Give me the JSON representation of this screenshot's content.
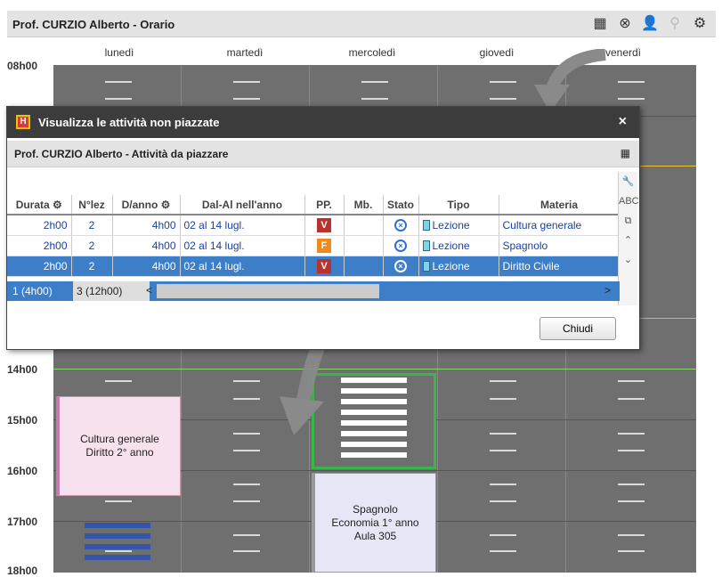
{
  "window": {
    "title": "Prof. CURZIO Alberto - Orario"
  },
  "toolbar_icons": [
    "timetable-icon",
    "cancel-icon",
    "person-icon",
    "search-icon",
    "gear-icon"
  ],
  "days": [
    "lunedì",
    "martedì",
    "mercoledì",
    "giovedì",
    "venerdì"
  ],
  "hours": [
    "08h00",
    "14h00",
    "15h00",
    "16h00",
    "17h00",
    "18h00"
  ],
  "schedule": {
    "card_monday": {
      "line1": "Cultura generale",
      "line2": "Diritto 2° anno"
    },
    "card_wednesday": {
      "line1": "Spagnolo",
      "line2": "Economia 1° anno",
      "line3": "Aula 305"
    }
  },
  "dialog": {
    "title": "Visualizza le attività non piazzate",
    "close": "×",
    "subtitle": "Prof. CURZIO Alberto - Attività da piazzare",
    "columns": [
      "Durata",
      "N°lez",
      "D/anno",
      "Dal-Al nell'anno",
      "PP.",
      "Mb.",
      "Stato",
      "Tipo",
      "Materia"
    ],
    "rows": [
      {
        "durata": "2h00",
        "nlez": "2",
        "danno": "4h00",
        "dal": "02 al 14 lugl.",
        "pp": "V",
        "pp_color": "#b8322e",
        "tipo": "Lezione",
        "materia": "Cultura generale",
        "selected": false
      },
      {
        "durata": "2h00",
        "nlez": "2",
        "danno": "4h00",
        "dal": "02 al 14 lugl.",
        "pp": "F",
        "pp_color": "#ef8a1c",
        "tipo": "Lezione",
        "materia": "Spagnolo",
        "selected": false
      },
      {
        "durata": "2h00",
        "nlez": "2",
        "danno": "4h00",
        "dal": "02 al 14 lugl.",
        "pp": "V",
        "pp_color": "#b8322e",
        "tipo": "Lezione",
        "materia": "Diritto Civile",
        "selected": true
      }
    ],
    "footer_a": "1 (4h00)",
    "footer_b": "3 (12h00)",
    "footer_left": "<",
    "footer_right": ">",
    "side_abc": "ABC",
    "close_button": "Chiudi"
  },
  "colors": {
    "selection": "#3d7ec9",
    "green_line": "#86d86b",
    "yellow_line": "#f1c232"
  }
}
